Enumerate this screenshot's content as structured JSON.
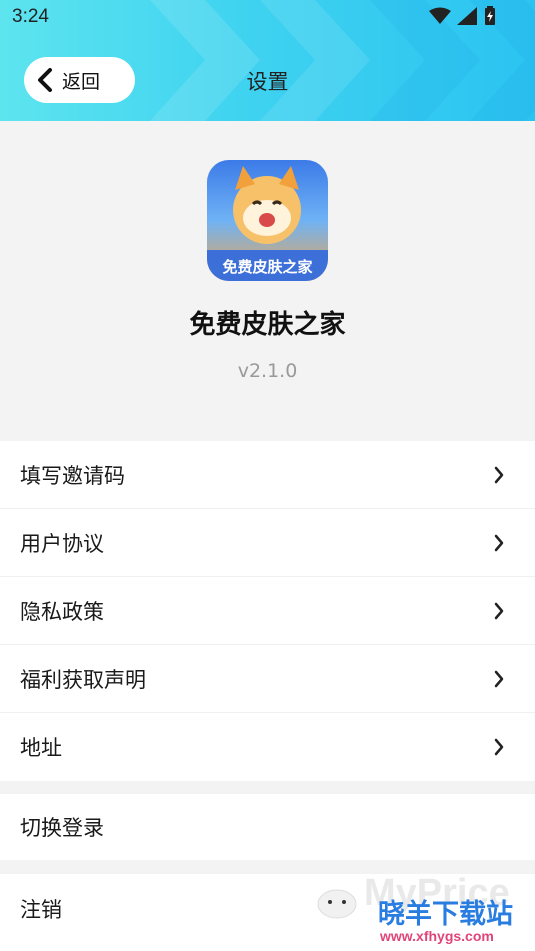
{
  "status_bar": {
    "time": "3:24",
    "icons": [
      "wifi-icon",
      "signal-icon",
      "battery-charging-icon"
    ]
  },
  "header": {
    "back_label": "返回",
    "title": "设置",
    "gradient_colors": [
      "#5de4ef",
      "#2bc3f1"
    ]
  },
  "app": {
    "name": "免费皮肤之家",
    "version": "v2.1.0",
    "icon_text": "免费皮肤之家"
  },
  "menu_group_1": [
    {
      "label": "填写邀请码",
      "icon": "chevron-right-icon"
    },
    {
      "label": "用户协议",
      "icon": "chevron-right-icon"
    },
    {
      "label": "隐私政策",
      "icon": "chevron-right-icon"
    },
    {
      "label": "福利获取声明",
      "icon": "chevron-right-icon"
    },
    {
      "label": "地址",
      "icon": "chevron-right-icon"
    }
  ],
  "menu_group_2": [
    {
      "label": "切换登录"
    }
  ],
  "menu_group_3": [
    {
      "label": "注销"
    }
  ],
  "watermark": {
    "title": "晓羊下载站",
    "url": "www.xfhygs.com",
    "faint_text": "MyPrice"
  }
}
